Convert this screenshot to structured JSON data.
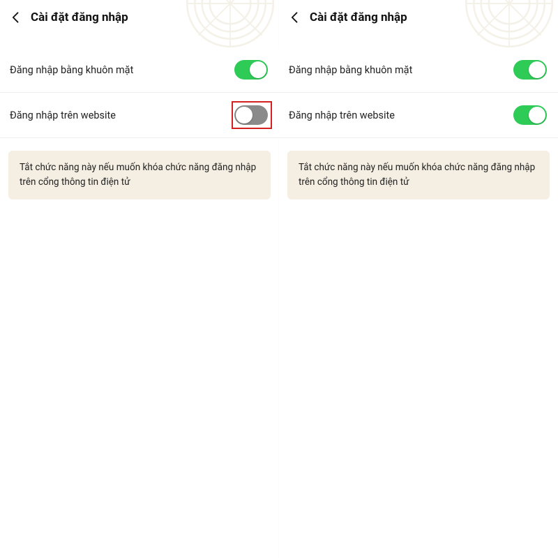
{
  "left": {
    "header": {
      "title": "Cài đặt đăng nhập"
    },
    "rows": [
      {
        "label": "Đăng nhập bằng khuôn mặt",
        "on": true
      },
      {
        "label": "Đăng nhập trên website",
        "on": false,
        "highlight": true
      }
    ],
    "info": "Tắt chức năng này nếu muốn khóa chức năng đăng nhập trên cổng thông tin điện tử"
  },
  "right": {
    "header": {
      "title": "Cài đặt đăng nhập"
    },
    "rows": [
      {
        "label": "Đăng nhập bằng khuôn mặt",
        "on": true
      },
      {
        "label": "Đăng nhập trên website",
        "on": true
      }
    ],
    "info": "Tắt chức năng này nếu muốn khóa chức năng đăng nhập trên cổng thông tin điện tử"
  },
  "colors": {
    "accent": "#2ecc57",
    "highlight": "#d32020",
    "info_bg": "#f5efe3"
  }
}
